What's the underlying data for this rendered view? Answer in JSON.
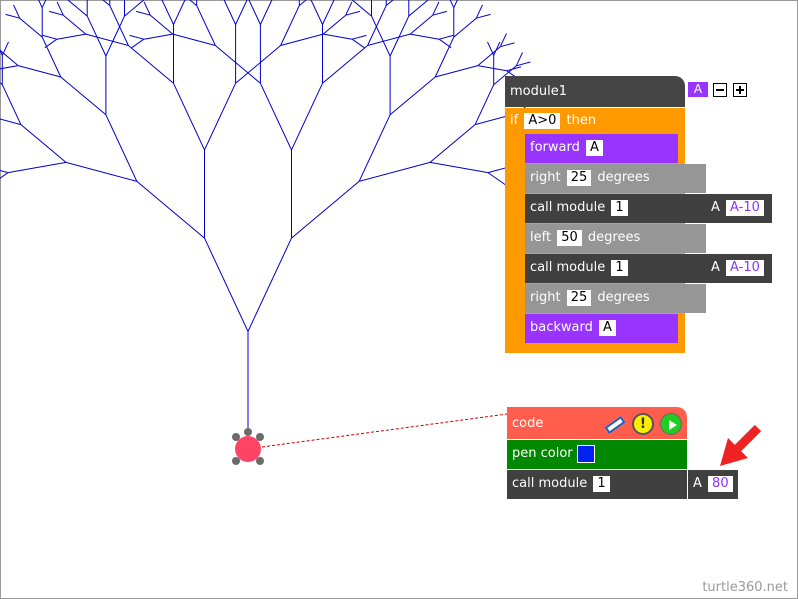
{
  "colors": {
    "module_header": "#454545",
    "if_block": "#ff9900",
    "move_block": "#9933ff",
    "turn_block": "#969696",
    "call_block": "#404040",
    "code_header": "#ff5e4f",
    "pen_block": "#008800",
    "tree_line": "#0000cc",
    "turtle": "#ff4466",
    "arrow": "#ee2222",
    "pen_swatch": "#0022ee"
  },
  "module": {
    "title": "module1",
    "param_badge": "A",
    "minus_icon": "minus-box-icon",
    "plus_icon": "plus-box-icon",
    "if_keyword": "if",
    "condition": "A>0",
    "then_keyword": "then",
    "lines": [
      {
        "kind": "forward",
        "label": "forward",
        "value": "A"
      },
      {
        "kind": "right",
        "label": "right",
        "value": "25",
        "unit": "degrees"
      },
      {
        "kind": "call",
        "label": "call module",
        "value": "1",
        "param": "A",
        "arg": "A-10"
      },
      {
        "kind": "left",
        "label": "left",
        "value": "50",
        "unit": "degrees"
      },
      {
        "kind": "call",
        "label": "call module",
        "value": "1",
        "param": "A",
        "arg": "A-10"
      },
      {
        "kind": "right",
        "label": "right",
        "value": "25",
        "unit": "degrees"
      },
      {
        "kind": "backward",
        "label": "backward",
        "value": "A"
      }
    ]
  },
  "code": {
    "title": "code",
    "eraser_icon": "eraser-icon",
    "warning_icon": "exclamation-icon",
    "run_icon": "play-icon",
    "pen_label": "pen color",
    "call_label": "call module",
    "call_value": "1",
    "param": "A",
    "arg": "80"
  },
  "watermark": "turtle360.net"
}
